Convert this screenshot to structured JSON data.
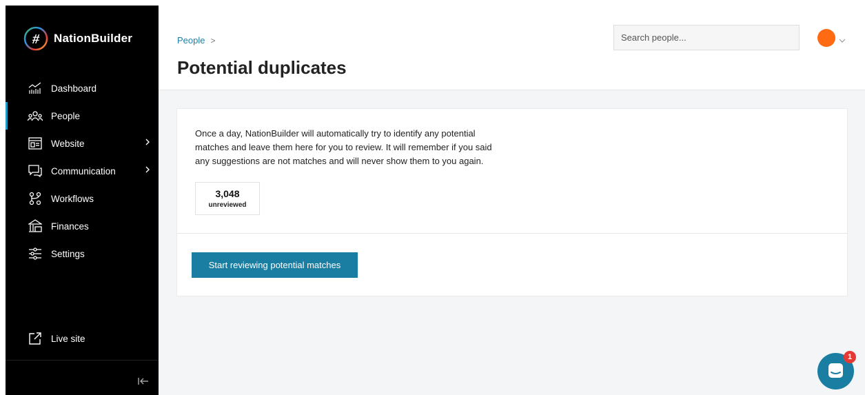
{
  "brand": {
    "name": "NationBuilder",
    "logo_glyph": "#"
  },
  "sidebar": {
    "items": [
      {
        "label": "Dashboard",
        "icon": "chart-icon",
        "active": false
      },
      {
        "label": "People",
        "icon": "people-icon",
        "active": true
      },
      {
        "label": "Website",
        "icon": "website-icon",
        "active": false,
        "has_submenu": true
      },
      {
        "label": "Communication",
        "icon": "chat-bubbles-icon",
        "active": false,
        "has_submenu": true
      },
      {
        "label": "Workflows",
        "icon": "workflow-icon",
        "active": false
      },
      {
        "label": "Finances",
        "icon": "finances-icon",
        "active": false
      },
      {
        "label": "Settings",
        "icon": "sliders-icon",
        "active": false
      }
    ],
    "live_site": "Live site",
    "collapse_glyph": "|←"
  },
  "header": {
    "breadcrumb": "People",
    "breadcrumb_sep": ">",
    "title": "Potential duplicates",
    "search_placeholder": "Search people..."
  },
  "main": {
    "description": "Once a day, NationBuilder will automatically try to identify any potential matches and leave them here for you to review. It will remember if you said any suggestions are not matches and will never show them to you again.",
    "stat_value": "3,048",
    "stat_label": "unreviewed",
    "cta_label": "Start reviewing potential matches"
  },
  "chat": {
    "badge": "1"
  },
  "colors": {
    "accent": "#1a7ea3",
    "avatar": "#ff6a13",
    "sidebar": "#000000",
    "badge": "#e53935"
  }
}
